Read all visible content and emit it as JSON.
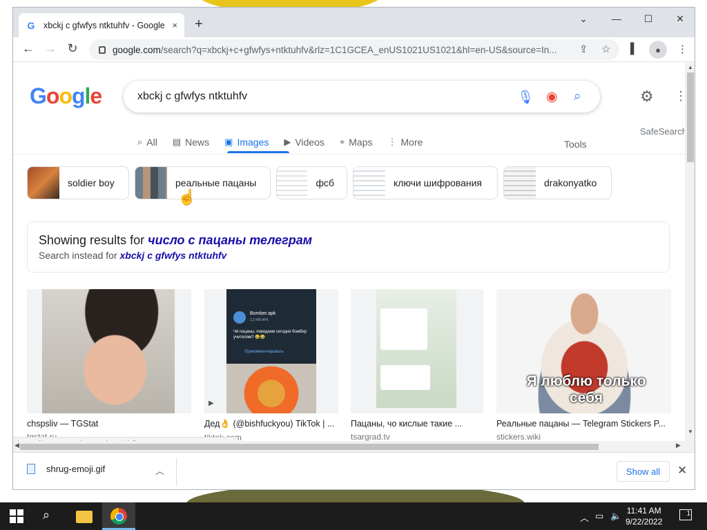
{
  "browser": {
    "tab_title": "xbckj c gfwfys ntktuhfv - Google",
    "tab_close": "×",
    "new_tab": "+",
    "url_host": "google.com",
    "url_path": "/search?q=xbckj+c+gfwfys+ntktuhfv&rlz=1C1GCEA_enUS1021US1021&hl=en-US&source=In...",
    "status_url": "https://www.google.com/search?q=число+с+пацаны+те..."
  },
  "google": {
    "logo": "Google",
    "query": "xbckj c gfwfys ntktuhfv",
    "tabs": [
      {
        "label": "All",
        "icon": "search-icon"
      },
      {
        "label": "News",
        "icon": "news-icon"
      },
      {
        "label": "Images",
        "icon": "images-icon",
        "active": true
      },
      {
        "label": "Videos",
        "icon": "play-icon"
      },
      {
        "label": "Maps",
        "icon": "map-pin-icon"
      },
      {
        "label": "More",
        "icon": "more-vertical-icon"
      }
    ],
    "tools": "Tools",
    "safesearch": "SafeSearch",
    "chips": [
      "soldier boy",
      "реальные пацаны",
      "фсб",
      "ключи шифрования",
      "drakonyatko"
    ],
    "notice": {
      "showing_prefix": "Showing results for",
      "showing_query": "число с пацаны телеграм",
      "instead_prefix": "Search instead for",
      "instead_query": "xbckj c gfwfys ntktuhfv"
    },
    "results": [
      {
        "caption": "chspsliv — TGStat",
        "source": "tgstat.ru"
      },
      {
        "caption": "Дед👌 (@bishfuckyou) TikTok | ...",
        "source": "tiktok.com",
        "img_title": "Bomber.apk",
        "img_sub": "2,3 MB APK",
        "img_msg": "Чё пацаны, покидаем сегодня бомбер учителям? 😂😂",
        "img_btn": "Прокомментировать"
      },
      {
        "caption": "Пацаны, чо кислые такие ...",
        "source": "tsargrad.tv"
      },
      {
        "caption": "Реальные пацаны — Telegram Stickers P...",
        "source": "stickers.wiki",
        "img_text": "Я люблю только себя"
      }
    ]
  },
  "downloads": {
    "file": "shrug-emoji.gif",
    "show_all": "Show all"
  },
  "taskbar": {
    "time": "11:41 AM",
    "date": "9/22/2022",
    "notifications": "1"
  },
  "colors": {
    "accent": "#1a73e8",
    "link": "#1a0dab",
    "taskbar": "#1c1c1c"
  }
}
